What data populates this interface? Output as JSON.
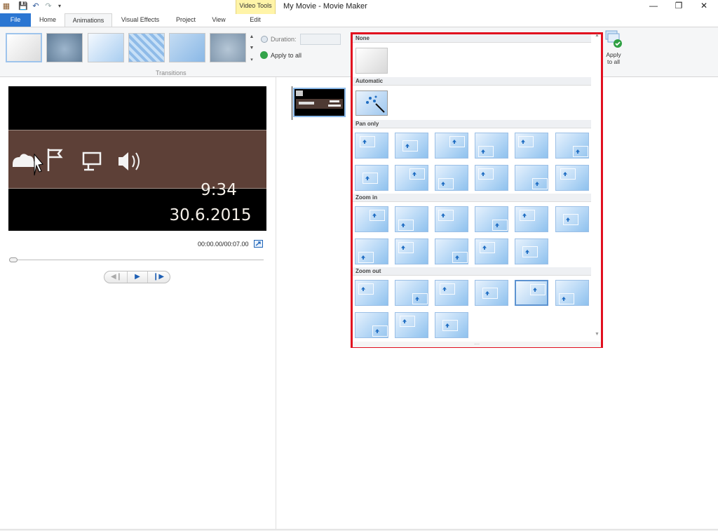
{
  "window": {
    "title": "My Movie - Movie Maker",
    "contextual_group": "Video Tools",
    "minimize": "—",
    "restore": "❐",
    "close": "✕"
  },
  "quick_access": {
    "save_icon": "save-icon",
    "undo_icon": "undo-icon",
    "redo_icon": "redo-icon"
  },
  "tabs": [
    {
      "label": "File"
    },
    {
      "label": "Home"
    },
    {
      "label": "Animations"
    },
    {
      "label": "Visual Effects"
    },
    {
      "label": "Project"
    },
    {
      "label": "View"
    },
    {
      "label": "Edit"
    }
  ],
  "ribbon": {
    "group_label": "Transitions",
    "duration_label": "Duration:",
    "apply_to_all_label": "Apply to all",
    "apply_to_all_big_label_line1": "Apply",
    "apply_to_all_big_label_line2": "to all"
  },
  "preview": {
    "time": "9:34",
    "date": "30.6.2015",
    "timecode": "00:00.00/00:07.00"
  },
  "gallery": {
    "categories": [
      "None",
      "Automatic",
      "Pan only",
      "Zoom in",
      "Zoom out"
    ],
    "grip": "....",
    "scroll_up": "▲",
    "scroll_down": "▼"
  },
  "colors": {
    "highlight_border": "#e10f1f",
    "file_tab": "#2b76d2",
    "contextual": "#fff4a8",
    "thumb_blue": "#9cc8ee"
  }
}
